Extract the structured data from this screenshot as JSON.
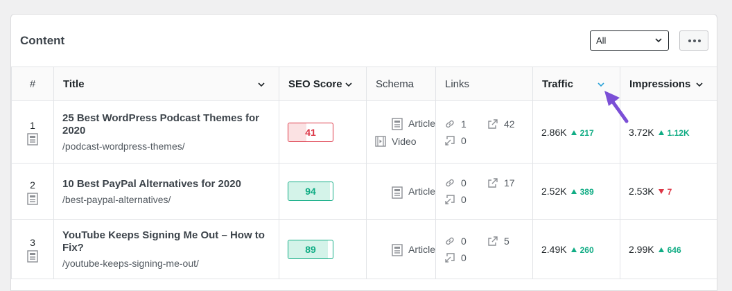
{
  "panel": {
    "title": "Content"
  },
  "filter": {
    "value": "All"
  },
  "columns": {
    "num": "#",
    "title": "Title",
    "seo": "SEO Score",
    "schema": "Schema",
    "links": "Links",
    "traffic": "Traffic",
    "impressions": "Impressions"
  },
  "rows": [
    {
      "num": "1",
      "title": "25 Best WordPress Podcast Themes for 2020",
      "slug": "/podcast-wordpress-themes/",
      "seo_score": "41",
      "seo_status": "bad",
      "seo_fill_fraction": 0.41,
      "schemas": [
        {
          "icon": "article-icon",
          "label": "Article"
        },
        {
          "icon": "video-icon",
          "label": "Video"
        }
      ],
      "links": {
        "internal": "1",
        "external": "42",
        "incoming": "0"
      },
      "traffic": {
        "value": "2.86K",
        "delta": "217",
        "direction": "up"
      },
      "impressions": {
        "value": "3.72K",
        "delta": "1.12K",
        "direction": "up"
      }
    },
    {
      "num": "2",
      "title": "10 Best PayPal Alternatives for 2020",
      "slug": "/best-paypal-alternatives/",
      "seo_score": "94",
      "seo_status": "good",
      "seo_fill_fraction": 0.94,
      "schemas": [
        {
          "icon": "article-icon",
          "label": "Article"
        }
      ],
      "links": {
        "internal": "0",
        "external": "17",
        "incoming": "0"
      },
      "traffic": {
        "value": "2.52K",
        "delta": "389",
        "direction": "up"
      },
      "impressions": {
        "value": "2.53K",
        "delta": "7",
        "direction": "down"
      }
    },
    {
      "num": "3",
      "title": "YouTube Keeps Signing Me Out – How to Fix?",
      "slug": "/youtube-keeps-signing-me-out/",
      "seo_score": "89",
      "seo_status": "good",
      "seo_fill_fraction": 0.89,
      "schemas": [
        {
          "icon": "article-icon",
          "label": "Article"
        }
      ],
      "links": {
        "internal": "0",
        "external": "5",
        "incoming": "0"
      },
      "traffic": {
        "value": "2.49K",
        "delta": "260",
        "direction": "up"
      },
      "impressions": {
        "value": "2.99K",
        "delta": "646",
        "direction": "up"
      }
    }
  ],
  "colors": {
    "good": "#10ac84",
    "bad": "#dc3545",
    "sort_active": "#2aa3d8",
    "pointer": "#7b4fd6"
  }
}
